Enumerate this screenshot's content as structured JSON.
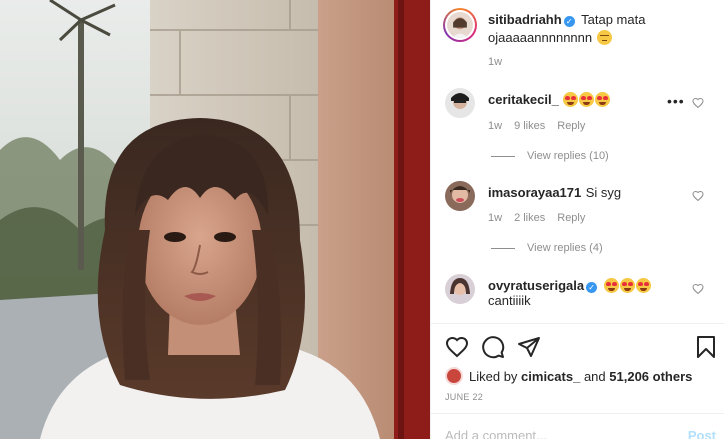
{
  "post": {
    "author": "sitibadriahh",
    "verified": true,
    "caption": "Tatap mata ojaaaaannnnnnnn",
    "age": "1w"
  },
  "comments": [
    {
      "user": "ceritakecil_",
      "verified": false,
      "text": "",
      "emoji_count": 3,
      "age": "1w",
      "likes": "9 likes",
      "reply": "Reply",
      "view_replies": "View replies (10)"
    },
    {
      "user": "imasorayaa171",
      "verified": false,
      "text": "Si syg",
      "age": "1w",
      "likes": "2 likes",
      "reply": "Reply",
      "view_replies": "View replies (4)"
    },
    {
      "user": "ovyratuserigala",
      "verified": true,
      "text": "cantiiiik",
      "emoji_count": 3
    }
  ],
  "actions": {
    "like_icon": "heart-icon",
    "comment_icon": "comment-bubble-icon",
    "share_icon": "paper-plane-icon",
    "save_icon": "bookmark-icon"
  },
  "likes": {
    "prefix": "Liked by",
    "user": "cimicats_",
    "middle": "and",
    "count": "51,206 others"
  },
  "date": "JUNE 22",
  "add_comment": {
    "placeholder": "Add a comment...",
    "post_label": "Post"
  },
  "colors": {
    "verified": "#3897f0",
    "meta_gray": "#8e8e8e",
    "post_disabled": "#b2dffc"
  }
}
